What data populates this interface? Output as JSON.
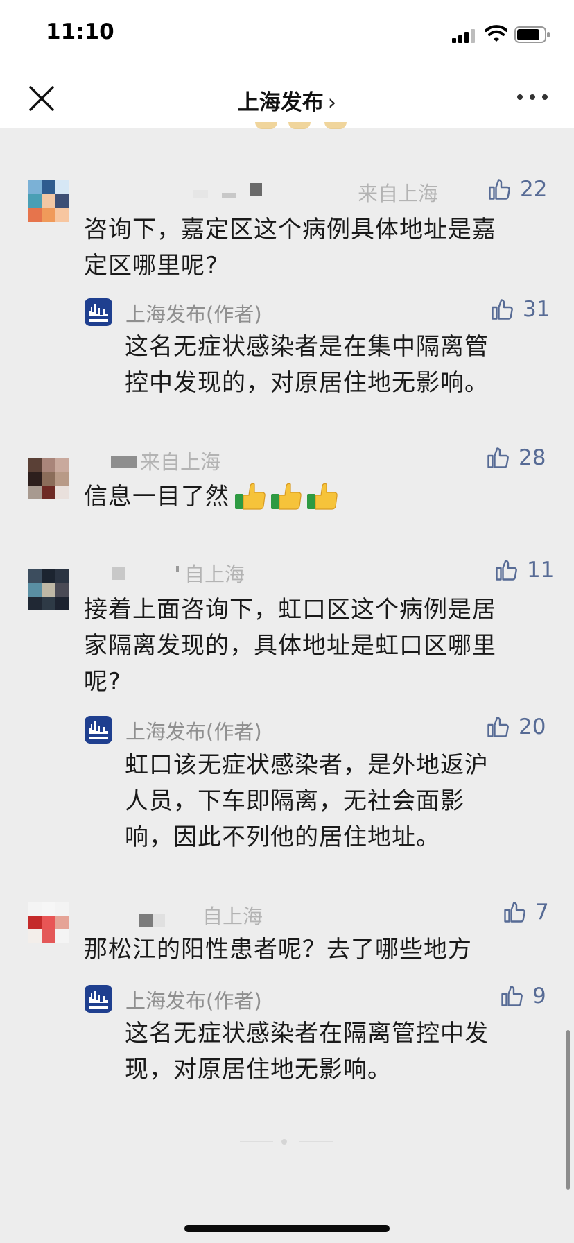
{
  "status_bar": {
    "time": "11:10"
  },
  "nav": {
    "title": "上海发布",
    "chevron": "›"
  },
  "icons": {
    "close": "close-icon",
    "more": "more-dots-icon",
    "like": "thumbs-up-icon",
    "author_logo": "shanghai-fabu-logo",
    "emoji": "thumbs-up-emoji"
  },
  "colors": {
    "like": "#576b95",
    "location": "#b3b3b3",
    "author": "#8f8f8f",
    "text": "#1a1a1a"
  },
  "comments": [
    {
      "location": "来自上海",
      "likes": "22",
      "text_lines": [
        "咨询下，嘉定区这个病例具体地址是嘉",
        "定区哪里呢?"
      ],
      "reply": {
        "author": "上海发布(作者)",
        "likes": "31",
        "text_lines": [
          "这名无症状感染者是在集中隔离管",
          "控中发现的，对原居住地无影响。"
        ]
      }
    },
    {
      "location": "来自上海",
      "likes": "28",
      "text": "信息一目了然"
    },
    {
      "location": "自上海",
      "likes": "11",
      "text_lines": [
        "接着上面咨询下，虹口区这个病例是居",
        "家隔离发现的，具体地址是虹口区哪里",
        "呢?"
      ],
      "reply": {
        "author": "上海发布(作者)",
        "likes": "20",
        "text_lines": [
          "虹口该无症状感染者，是外地返沪",
          "人员，下车即隔离，无社会面影",
          "响，因此不列他的居住地址。"
        ]
      }
    },
    {
      "location": "自上海",
      "likes": "7",
      "text": "那松江的阳性患者呢？去了哪些地方",
      "reply": {
        "author": "上海发布(作者)",
        "likes": "9",
        "text_lines": [
          "这名无症状感染者在隔离管控中发",
          "现，对原居住地无影响。"
        ]
      }
    }
  ]
}
